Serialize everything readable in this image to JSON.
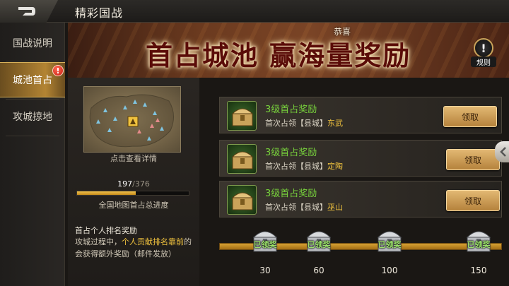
{
  "header": {
    "title": "精彩国战"
  },
  "nav": {
    "items": [
      {
        "label": "国战说明",
        "active": false
      },
      {
        "label": "城池首占",
        "active": true,
        "badge": "!"
      },
      {
        "label": "攻城掠地",
        "active": false
      }
    ]
  },
  "banner": {
    "headline": "首占城池 赢海量奖励",
    "congrats": "恭喜",
    "rules_label": "规则",
    "rules_icon_text": "!"
  },
  "info": {
    "map_hint": "点击查看详情",
    "progress_current": "197",
    "progress_total": "/376",
    "progress_fraction": 0.524,
    "progress_label": "全国地图首占总进度",
    "rank_title": "首占个人排名奖励",
    "rank_desc_pre": "攻城过程中，",
    "rank_desc_hl": "个人贡献排名靠前",
    "rank_desc_post": "的会获得额外奖励（邮件发放）"
  },
  "rewards": [
    {
      "title": "3级首占奖励",
      "desc_prefix": "首次占领【县城】",
      "city": "东武",
      "button": "领取"
    },
    {
      "title": "3级首占奖励",
      "desc_prefix": "首次占领【县城】",
      "city": "定陶",
      "button": "领取"
    },
    {
      "title": "3级首占奖励",
      "desc_prefix": "首次占领【县城】",
      "city": "巫山",
      "button": "领取"
    }
  ],
  "milestones": [
    {
      "value": "30",
      "status": "已领奖"
    },
    {
      "value": "60",
      "status": "已领奖"
    },
    {
      "value": "100",
      "status": "已领奖"
    },
    {
      "value": "150",
      "status": "已领奖"
    }
  ],
  "colors": {
    "accent_gold": "#f0c23e",
    "reward_green": "#78d23c",
    "claimed_green": "#9be06b",
    "alert_red": "#c81d10"
  }
}
